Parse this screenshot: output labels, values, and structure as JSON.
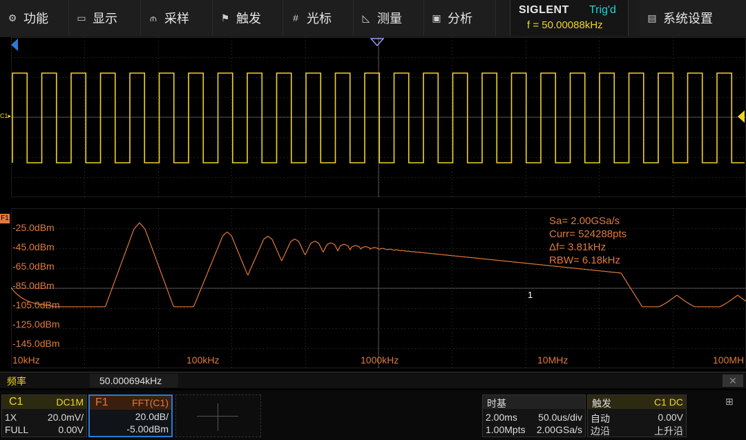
{
  "menu": {
    "items": [
      {
        "label": "功能",
        "icon": "gear-icon"
      },
      {
        "label": "显示",
        "icon": "monitor-icon"
      },
      {
        "label": "采样",
        "icon": "sample-icon"
      },
      {
        "label": "触发",
        "icon": "flag-icon"
      },
      {
        "label": "光标",
        "icon": "cursor-icon"
      },
      {
        "label": "测量",
        "icon": "ruler-icon"
      },
      {
        "label": "分析",
        "icon": "analysis-icon"
      }
    ],
    "brand": "SIGLENT",
    "trigger_state": "Trig'd",
    "frequency": "f = 50.00088kHz",
    "system_settings": "系统设置"
  },
  "channel": {
    "marker": "C1"
  },
  "fft": {
    "marker": "F1",
    "y_labels": [
      "-25.0dBm",
      "-45.0dBm",
      "-65.0dBm",
      "-85.0dBm",
      "-105.0dBm",
      "-125.0dBm",
      "-145.0dBm"
    ],
    "x_labels": [
      "10kHz",
      "100kHz",
      "1000kHz",
      "10MHz",
      "100MH"
    ],
    "info": [
      "Sa=  2.00GSa/s",
      "Curr= 524288pts",
      "Δf=  3.81kHz",
      "RBW=  6.18kHz"
    ],
    "marker_label": "1"
  },
  "measure": {
    "label": "频率",
    "value": "50.000694kHz",
    "close": "✕"
  },
  "c1_panel": {
    "tag": "C1",
    "coupling": "DC1M",
    "probe": "1X",
    "scale": "20.0mV/",
    "bandwidth": "FULL",
    "offset": "0.00V"
  },
  "f1_panel": {
    "tag": "F1",
    "source": "FFT(C1)",
    "scale": "20.0dB/",
    "offset": "-5.00dBm"
  },
  "timebase": {
    "title": "时基",
    "delay": "2.00ms",
    "scale": "50.0us/div",
    "depth": "1.00Mpts",
    "rate": "2.00GSa/s"
  },
  "trigger": {
    "title": "触发",
    "source": "C1 DC",
    "mode": "自动",
    "level": "0.00V",
    "type": "边沿",
    "slope": "上升沿"
  },
  "colors": {
    "ch1": "#f0d428",
    "fft": "#e07a3c",
    "trig": "#1fd2d6"
  },
  "chart_data": {
    "type": "line",
    "x_scale": "log",
    "xlabels": [
      "10kHz",
      "100kHz",
      "1000kHz",
      "10MHz",
      "100MH"
    ],
    "ylabels": [
      "-25.0dBm",
      "-45.0dBm",
      "-65.0dBm",
      "-85.0dBm",
      "-105.0dBm",
      "-125.0dBm",
      "-145.0dBm"
    ],
    "fundamental_khz": 50,
    "peaks": [
      {
        "freq_khz": 50,
        "level_dbm": -20
      },
      {
        "freq_khz": 150,
        "level_dbm": -30
      },
      {
        "freq_khz": 250,
        "level_dbm": -36
      },
      {
        "freq_khz": 350,
        "level_dbm": -40
      },
      {
        "freq_khz": 450,
        "level_dbm": -44
      }
    ]
  }
}
